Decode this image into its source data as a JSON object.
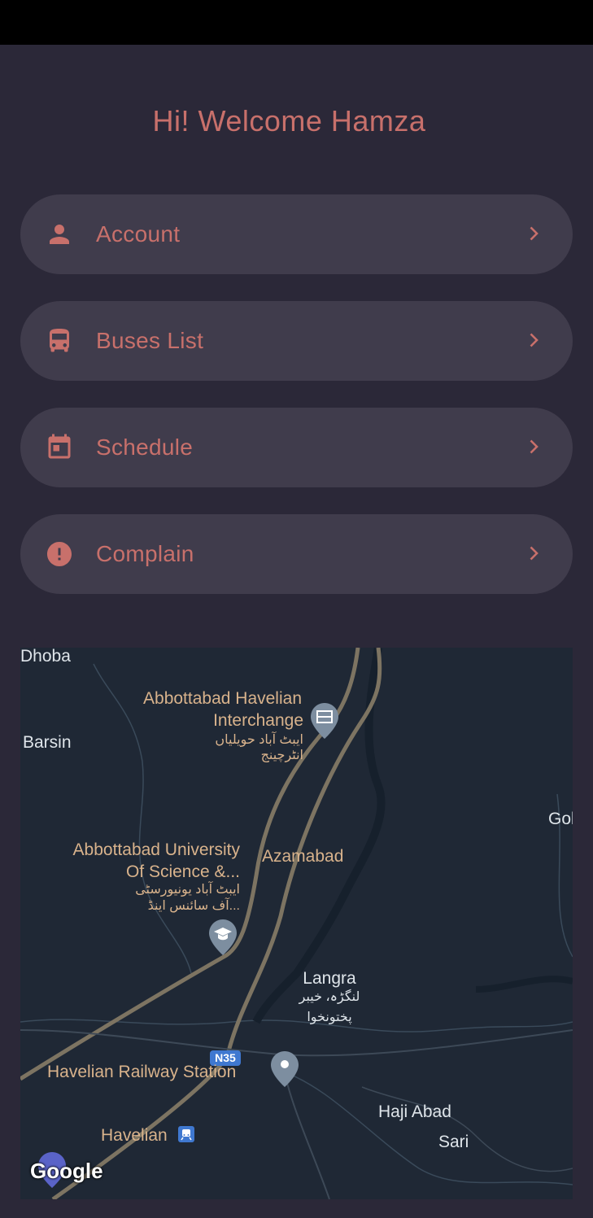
{
  "header": {
    "welcome_text": "Hi! Welcome Hamza"
  },
  "menu": [
    {
      "label": "Account",
      "icon": "person-icon"
    },
    {
      "label": "Buses List",
      "icon": "bus-icon"
    },
    {
      "label": "Schedule",
      "icon": "calendar-icon"
    },
    {
      "label": "Complain",
      "icon": "alert-icon"
    }
  ],
  "map": {
    "labels": {
      "dhoba": "Dhoba",
      "barsin": "Barsin",
      "interchange_en_1": "Abbottabad Havelian",
      "interchange_en_2": "Interchange",
      "interchange_ur_1": "ایبٹ آباد حویلیاں",
      "interchange_ur_2": "انٹرچینج",
      "gol": "Gol",
      "azamabad": "Azamabad",
      "university_en_1": "Abbottabad University",
      "university_en_2": "Of Science &...",
      "university_ur_1": "ایبٹ آباد یونیورسٹی",
      "university_ur_2": "آف سائنس اینڈ...",
      "langra_en": "Langra",
      "langra_ur_1": "لنگڑہ، خیبر",
      "langra_ur_2": "پختونخوا",
      "road": "N35",
      "railway_station": "Havelian Railway Station",
      "haji_abad": "Haji Abad",
      "sari": "Sari",
      "havelian": "Havelian",
      "google": "Google"
    }
  },
  "colors": {
    "background": "#2b2838",
    "card": "#403c4c",
    "accent": "#c8706b",
    "map_bg": "#1f2835",
    "map_label": "#d9b38c"
  }
}
